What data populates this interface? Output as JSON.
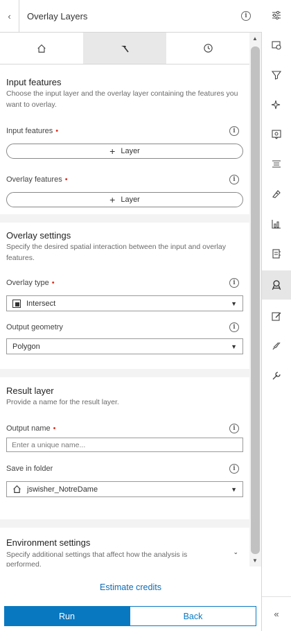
{
  "header": {
    "title": "Overlay Layers",
    "back_icon": "chevron-left-icon",
    "info_icon": "info-icon"
  },
  "tabs": [
    {
      "name": "home",
      "icon": "home-icon",
      "active": false
    },
    {
      "name": "tools",
      "icon": "hammer-icon",
      "active": true
    },
    {
      "name": "history",
      "icon": "history-icon",
      "active": false
    }
  ],
  "input_features": {
    "title": "Input features",
    "description": "Choose the input layer and the overlay layer containing the features you want to overlay.",
    "input_label": "Input features",
    "overlay_label": "Overlay features",
    "layer_button": "Layer"
  },
  "overlay_settings": {
    "title": "Overlay settings",
    "description": "Specify the desired spatial interaction between the input and overlay features.",
    "type_label": "Overlay type",
    "type_value": "Intersect",
    "geometry_label": "Output geometry",
    "geometry_value": "Polygon"
  },
  "result_layer": {
    "title": "Result layer",
    "description": "Provide a name for the result layer.",
    "name_label": "Output name",
    "name_placeholder": "Enter a unique name...",
    "folder_label": "Save in folder",
    "folder_value": "jswisher_NotreDame"
  },
  "environment": {
    "title": "Environment settings",
    "description": "Specify additional settings that affect how the analysis is performed."
  },
  "footer": {
    "estimate": "Estimate credits",
    "run": "Run",
    "back": "Back"
  },
  "rail": [
    "sliders-icon",
    "map-layers-icon",
    "filter-icon",
    "sparkle-icon",
    "config-popup-icon",
    "fields-icon",
    "style-icon",
    "charts-icon",
    "table-icon",
    "analysis-icon",
    "edit-icon",
    "sketch-icon",
    "wrench-icon"
  ],
  "colors": {
    "accent": "#0879c1",
    "required": "#d83020"
  }
}
